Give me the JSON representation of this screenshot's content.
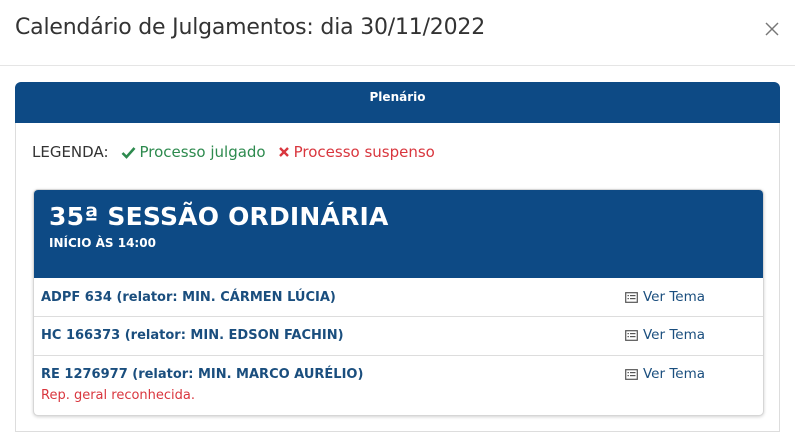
{
  "modal": {
    "title": "Calendário de Julgamentos: dia 30/11/2022"
  },
  "panel": {
    "heading": "Plenário"
  },
  "legend": {
    "label": "LEGENDA:",
    "julgado": "Processo julgado",
    "suspenso": "Processo suspenso",
    "julgado_color": "#2d8a4e",
    "suspenso_color": "#d9363e"
  },
  "session": {
    "title": "35ª SESSÃO ORDINÁRIA",
    "start": "INÍCIO ÀS 14:00",
    "cases": [
      {
        "title": "ADPF 634 (relator: MIN. CÁRMEN LÚCIA)",
        "link": "Ver Tema",
        "note": ""
      },
      {
        "title": "HC 166373 (relator: MIN. EDSON FACHIN)",
        "link": "Ver Tema",
        "note": ""
      },
      {
        "title": "RE 1276977 (relator: MIN. MARCO AURÉLIO)",
        "link": "Ver Tema",
        "note": "Rep. geral reconhecida."
      }
    ]
  },
  "colors": {
    "brand_blue": "#0d4a85",
    "link_blue": "#1a4e7e"
  }
}
